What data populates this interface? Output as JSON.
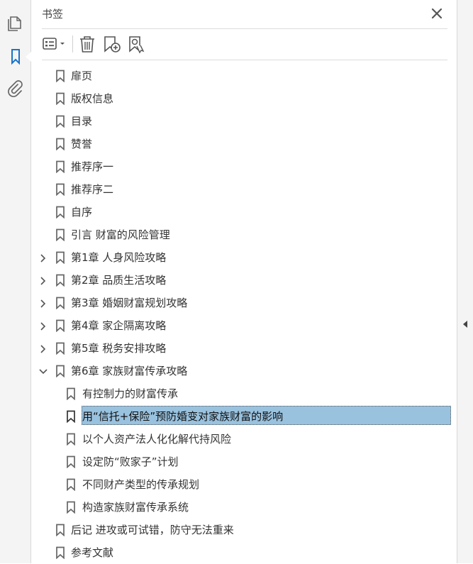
{
  "panel": {
    "title": "书签"
  },
  "rail": {
    "icons": [
      "pages-icon",
      "bookmark-icon",
      "attachment-icon"
    ]
  },
  "toolbar": {
    "options_icon": "list-options-icon",
    "delete_icon": "trash-icon",
    "new_bookmark_icon": "new-bookmark-icon",
    "new_from_structure_icon": "bookmark-from-structure-icon"
  },
  "bookmarks": [
    {
      "label": "扉页",
      "level": 0,
      "expander": "none"
    },
    {
      "label": "版权信息",
      "level": 0,
      "expander": "none"
    },
    {
      "label": "目录",
      "level": 0,
      "expander": "none"
    },
    {
      "label": "赞誉",
      "level": 0,
      "expander": "none"
    },
    {
      "label": "推荐序一",
      "level": 0,
      "expander": "none"
    },
    {
      "label": "推荐序二",
      "level": 0,
      "expander": "none"
    },
    {
      "label": "自序",
      "level": 0,
      "expander": "none"
    },
    {
      "label": "引言 财富的风险管理",
      "level": 0,
      "expander": "none"
    },
    {
      "label": "第1章 人身风险攻略",
      "level": 0,
      "expander": "collapsed"
    },
    {
      "label": "第2章 品质生活攻略",
      "level": 0,
      "expander": "collapsed"
    },
    {
      "label": "第3章 婚姻财富规划攻略",
      "level": 0,
      "expander": "collapsed"
    },
    {
      "label": "第4章 家企隔离攻略",
      "level": 0,
      "expander": "collapsed"
    },
    {
      "label": "第5章 税务安排攻略",
      "level": 0,
      "expander": "collapsed"
    },
    {
      "label": "第6章 家族财富传承攻略",
      "level": 0,
      "expander": "expanded"
    },
    {
      "label": "有控制力的财富传承",
      "level": 1,
      "expander": "none"
    },
    {
      "label": "用“信托+保险”预防婚变对家族财富的影响",
      "level": 1,
      "expander": "none",
      "selected": true
    },
    {
      "label": "以个人资产法人化化解代持风险",
      "level": 1,
      "expander": "none"
    },
    {
      "label": "设定防“败家子”计划",
      "level": 1,
      "expander": "none"
    },
    {
      "label": "不同财产类型的传承规划",
      "level": 1,
      "expander": "none"
    },
    {
      "label": "构造家族财富传承系统",
      "level": 1,
      "expander": "none"
    },
    {
      "label": "后记 进攻或可试错，防守无法重来",
      "level": 0,
      "expander": "none"
    },
    {
      "label": "参考文献",
      "level": 0,
      "expander": "none"
    }
  ],
  "colors": {
    "selection": "#99c2df",
    "accent": "#1a73c9"
  }
}
